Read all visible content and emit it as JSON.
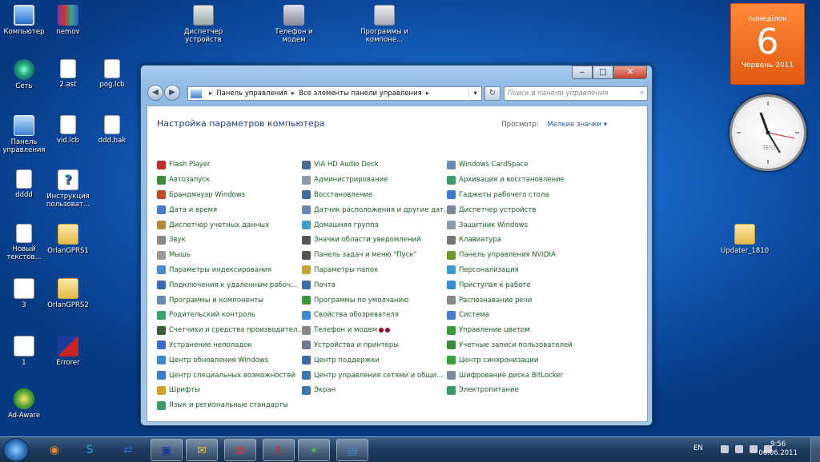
{
  "desktop_icons": [
    {
      "label": "Компьютер",
      "icon": "computer-icon",
      "cls": "ic-comp"
    },
    {
      "label": "nemov",
      "icon": "winrar-icon",
      "cls": "ic-rar"
    },
    {
      "label": "Диспетчер устройств",
      "icon": "device-manager-icon",
      "cls": "ic-dev"
    },
    {
      "label": "Телефон и модем",
      "icon": "phone-modem-icon",
      "cls": "ic-tel"
    },
    {
      "label": "Программы и компоне...",
      "icon": "programs-icon",
      "cls": "ic-prog"
    },
    {
      "label": "Сеть",
      "icon": "network-icon",
      "cls": "ic-net"
    },
    {
      "label": "2.ast",
      "icon": "file-icon",
      "cls": "ic-doc"
    },
    {
      "label": "pog.lcb",
      "icon": "file-icon",
      "cls": "ic-doc"
    },
    {
      "label": "Панель управления",
      "icon": "control-panel-icon",
      "cls": "ic-cp"
    },
    {
      "label": "vid.lcb",
      "icon": "file-icon",
      "cls": "ic-doc"
    },
    {
      "label": "ddd.bak",
      "icon": "file-icon",
      "cls": "ic-doc"
    },
    {
      "label": "dddd",
      "icon": "document-icon",
      "cls": "ic-doc"
    },
    {
      "label": "Инструкция пользоват...",
      "icon": "help-file-icon",
      "cls": "ic-help"
    },
    {
      "label": "Новый текстов...",
      "icon": "text-document-icon",
      "cls": "ic-doc"
    },
    {
      "label": "OrlanGPRS1",
      "icon": "folder-icon",
      "cls": "ic-fold"
    },
    {
      "label": "3",
      "icon": "settings-file-icon",
      "cls": "ic-iniwhite"
    },
    {
      "label": "OrlanGPRS2",
      "icon": "folder-icon",
      "cls": "ic-fold"
    },
    {
      "label": "1",
      "icon": "file-icon",
      "cls": "ic-iniwhite"
    },
    {
      "label": "Errorer",
      "icon": "errorer-icon",
      "cls": "ic-err"
    },
    {
      "label": "Ad-Aware",
      "icon": "ad-aware-icon",
      "cls": "ic-ada"
    },
    {
      "label": "Updater_1810",
      "icon": "folder-icon",
      "cls": "ic-upd"
    }
  ],
  "calendar": {
    "weekday": "понеділок",
    "day": "6",
    "month_year": "Червень 2011"
  },
  "clock": {
    "label": "TEST"
  },
  "window": {
    "address": [
      "Панель управления",
      "Все элементы панели управления"
    ],
    "search_placeholder": "Поиск в панели управления",
    "title": "Настройка параметров компьютера",
    "view_label": "Просмотр:",
    "view_value": "Мелкие значки",
    "columns": [
      [
        {
          "label": "Flash Player",
          "color": "#c0302a"
        },
        {
          "label": "Автозапуск",
          "color": "#3a8a3a"
        },
        {
          "label": "Брандмауэр Windows",
          "color": "#c24a2a"
        },
        {
          "label": "Дата и время",
          "color": "#4a7ad0"
        },
        {
          "label": "Диспетчер учетных данных",
          "color": "#b08a3a"
        },
        {
          "label": "Звук",
          "color": "#888"
        },
        {
          "label": "Мышь",
          "color": "#999"
        },
        {
          "label": "Параметры индексирования",
          "color": "#4a8ad0"
        },
        {
          "label": "Подключения к удаленным рабоч...",
          "color": "#3a6ab0"
        },
        {
          "label": "Программы и компоненты",
          "color": "#6a8ab0"
        },
        {
          "label": "Родительский контроль",
          "color": "#3aa06a"
        },
        {
          "label": "Счетчики и средства производител...",
          "color": "#3a5a3a",
          "dots": 1
        },
        {
          "label": "Устранение неполадок",
          "color": "#3a6ad0"
        },
        {
          "label": "Центр обновления Windows",
          "color": "#3a8ad0"
        },
        {
          "label": "Центр специальных возможностей",
          "color": "#3a7ad0"
        },
        {
          "label": "Шрифты",
          "color": "#d0a030"
        },
        {
          "label": "Язык и региональные стандарты",
          "color": "#3a9a6a"
        }
      ],
      [
        {
          "label": "VIA HD Audio Deck",
          "color": "#4a6a9a"
        },
        {
          "label": "Администрирование",
          "color": "#8a9ab0"
        },
        {
          "label": "Восстановление",
          "color": "#3a6ab0"
        },
        {
          "label": "Датчик расположения и другие дат...",
          "color": "#6a8ab0"
        },
        {
          "label": "Домашняя группа",
          "color": "#3aa0d0"
        },
        {
          "label": "Значки области уведомлений",
          "color": "#555"
        },
        {
          "label": "Панель задач и меню \"Пуск\"",
          "color": "#555"
        },
        {
          "label": "Параметры папок",
          "color": "#d0a030"
        },
        {
          "label": "Почта",
          "color": "#3a6ab0"
        },
        {
          "label": "Программы по умолчанию",
          "color": "#3a9a3a"
        },
        {
          "label": "Свойства обозревателя",
          "color": "#3a8ad0"
        },
        {
          "label": "Телефон и модем",
          "color": "#888",
          "dots": 2
        },
        {
          "label": "Устройства и принтеры",
          "color": "#6a7a9a"
        },
        {
          "label": "Центр поддержки",
          "color": "#3a6ab0"
        },
        {
          "label": "Центр управления сетями и общи...",
          "color": "#3a7ab0"
        },
        {
          "label": "Экран",
          "color": "#3a7ab0"
        }
      ],
      [
        {
          "label": "Windows CardSpace",
          "color": "#6a8ab0"
        },
        {
          "label": "Архивация и восстановление",
          "color": "#3a9a6a"
        },
        {
          "label": "Гаджеты рабочего стола",
          "color": "#3a7ad0"
        },
        {
          "label": "Диспетчер устройств",
          "color": "#7a8a9a"
        },
        {
          "label": "Защитник Windows",
          "color": "#8a9ab0"
        },
        {
          "label": "Клавиатура",
          "color": "#777"
        },
        {
          "label": "Панель управления NVIDIA",
          "color": "#6a9a2a"
        },
        {
          "label": "Персонализация",
          "color": "#3a9ad0"
        },
        {
          "label": "Приступая к работе",
          "color": "#3a8ad0"
        },
        {
          "label": "Распознавание речи",
          "color": "#888"
        },
        {
          "label": "Система",
          "color": "#4a7ad0"
        },
        {
          "label": "Управление цветом",
          "color": "#3a9a3a"
        },
        {
          "label": "Учетные записи пользователей",
          "color": "#3a8a3a"
        },
        {
          "label": "Центр синхронизации",
          "color": "#3aa03a"
        },
        {
          "label": "Шифрование диска BitLocker",
          "color": "#7a8a9a"
        },
        {
          "label": "Электропитание",
          "color": "#3a9a6a"
        }
      ]
    ]
  },
  "taskbar": {
    "apps": [
      {
        "name": "firefox-icon",
        "glyph": "◉",
        "color": "#e8862a"
      },
      {
        "name": "skype-icon",
        "glyph": "S",
        "color": "#2aa0e0"
      },
      {
        "name": "teamviewer-icon",
        "glyph": "⇄",
        "color": "#2a6ad0"
      },
      {
        "name": "floppy-icon",
        "glyph": "▣",
        "color": "#1a3a9a"
      },
      {
        "name": "messenger-icon",
        "glyph": "✉",
        "color": "#e8c030"
      },
      {
        "name": "picasa-icon",
        "glyph": "✿",
        "color": "#d03a3a"
      },
      {
        "name": "antivirus-icon",
        "glyph": "§",
        "color": "#d02a2a"
      },
      {
        "name": "app-icon",
        "glyph": "✦",
        "color": "#5ab05a"
      },
      {
        "name": "control-panel-taskbar-icon",
        "glyph": "▤",
        "color": "#3a8ad0"
      }
    ],
    "lang": "EN",
    "time": "9:56",
    "date": "06.06.2011"
  }
}
